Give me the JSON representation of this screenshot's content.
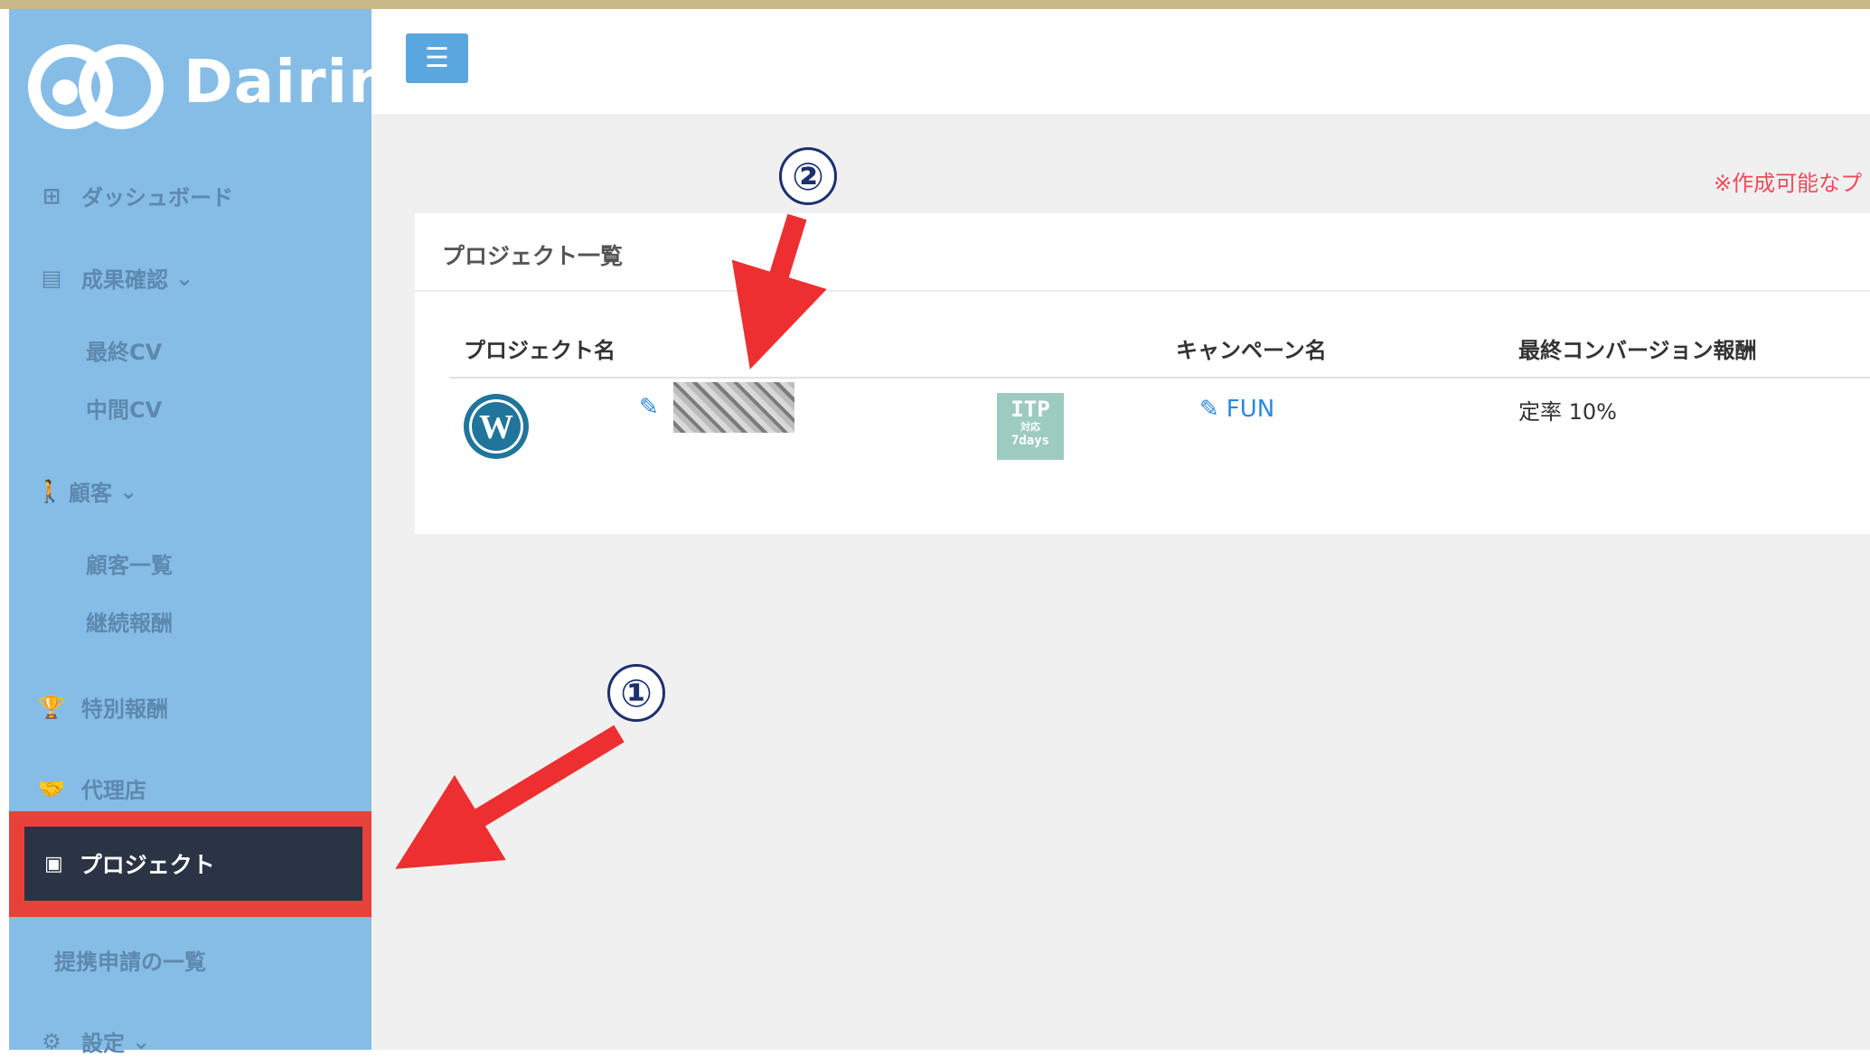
{
  "colors": {
    "sidebar": "#86bde6",
    "sidebar_text": "#5e88ad",
    "active_bg": "#2a3444",
    "highlight": "#e8413a",
    "accent": "#2a86e3",
    "notice": "#ef4a59",
    "annotation": "#1d2f6e"
  },
  "brand": {
    "name": "Dairin"
  },
  "sidebar": {
    "dashboard": {
      "label": "ダッシュボード",
      "icon": "grid-icon"
    },
    "results": {
      "label": "成果確認",
      "icon": "document-icon",
      "children": [
        "最終CV",
        "中間CV"
      ]
    },
    "customers": {
      "label": "顧客",
      "icon": "person-icon",
      "children": [
        "顧客一覧",
        "継続報酬"
      ]
    },
    "special": {
      "label": "特別報酬",
      "icon": "trophy-icon"
    },
    "agency": {
      "label": "代理店",
      "icon": "handshake-icon"
    },
    "project": {
      "label": "プロジェクト",
      "icon": "board-icon",
      "active": true
    },
    "partnership": {
      "label": "提携申請の一覧"
    },
    "settings": {
      "label": "設定",
      "icon": "gear-icon"
    }
  },
  "header": {
    "menu_icon": "☰"
  },
  "notice": "※作成可能なプ",
  "card": {
    "title": "プロジェクト一覧",
    "columns": [
      "プロジェクト名",
      "キャンペーン名",
      "最終コンバージョン報酬"
    ],
    "rows": [
      {
        "icon": "wordpress-icon",
        "name_blurred": true,
        "badge": {
          "line1": "ITP",
          "line2": "対応",
          "line3": "7days"
        },
        "campaign": "FUN",
        "reward": "定率 10%"
      }
    ]
  },
  "annotations": [
    {
      "number": "①",
      "target": "sidebar project menu item"
    },
    {
      "number": "②",
      "target": "project name edit link"
    }
  ]
}
